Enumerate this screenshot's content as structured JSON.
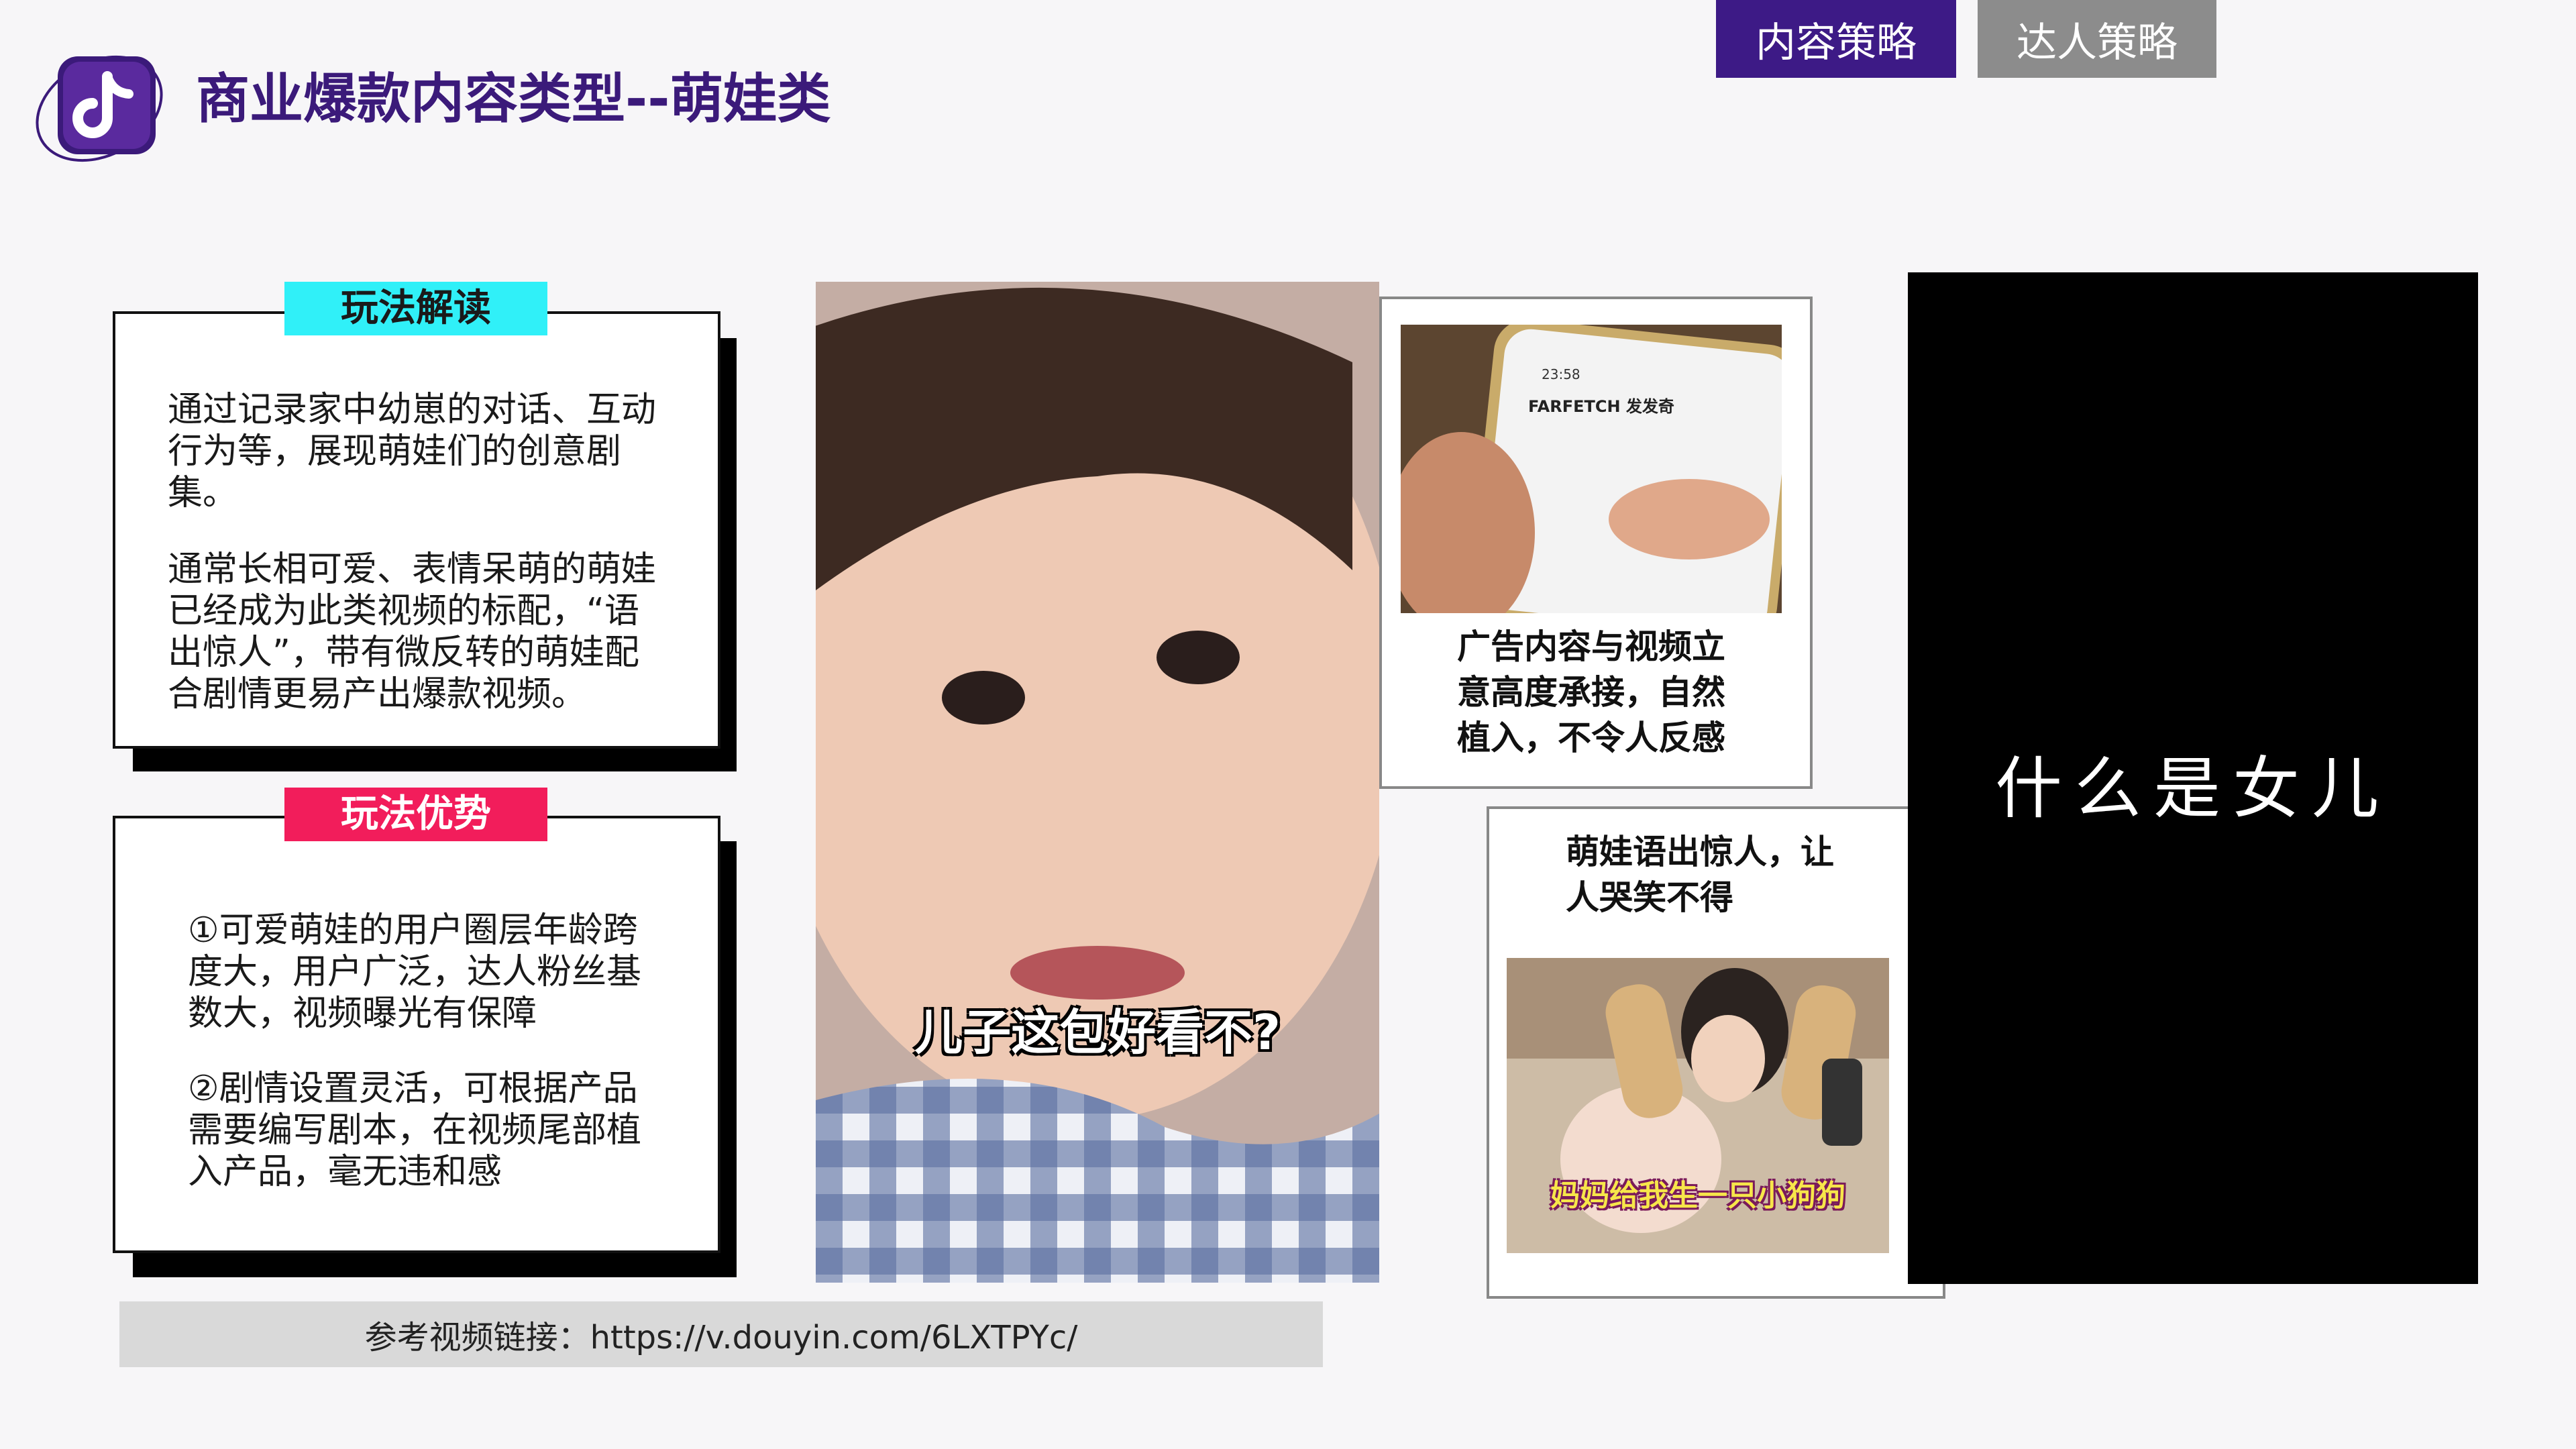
{
  "header": {
    "title": "商业爆款内容类型--萌娃类",
    "tabs": [
      "内容策略",
      "达人策略"
    ]
  },
  "interpret_card": {
    "label": "玩法解读",
    "para1": [
      "通过记录家中幼崽的对话、互动",
      "行为等，展现萌娃们的创意剧",
      "集。"
    ],
    "para2": [
      "通常长相可爱、表情呆萌的萌娃",
      "已经成为此类视频的标配，“语",
      "出惊人”，带有微反转的萌娃配",
      "合剧情更易产出爆款视频。"
    ]
  },
  "advantage_card": {
    "label": "玩法优势",
    "para1": [
      "①可爱萌娃的用户圈层年龄跨",
      "度大，用户广泛，达人粉丝基",
      "数大，视频曝光有保障"
    ],
    "para2": [
      "②剧情设置灵活，可根据产品",
      "需要编写剧本，在视频尾部植",
      "入产品，毫无违和感"
    ]
  },
  "main_video": {
    "caption": "儿子这包好看不?"
  },
  "ad_panel": {
    "phone_time": "23:58",
    "phone_brand": "FARFETCH 发发奇",
    "note": [
      "广告内容与视频立",
      "意高度承接，自然",
      "植入，不令人反感"
    ]
  },
  "kid_panel": {
    "note": [
      "萌娃语出惊人，让",
      "人哭笑不得"
    ],
    "caption": "妈妈给我生一只小狗狗"
  },
  "black_panel": {
    "text": "什么是女儿"
  },
  "reference": "参考视频链接：https://v.douyin.com/6LXTPYc/",
  "colors": {
    "brand_purple": "#3d1a86",
    "cyan": "#30f0f8",
    "pink": "#f21d5b",
    "gray_tab": "#8c8c8c"
  }
}
